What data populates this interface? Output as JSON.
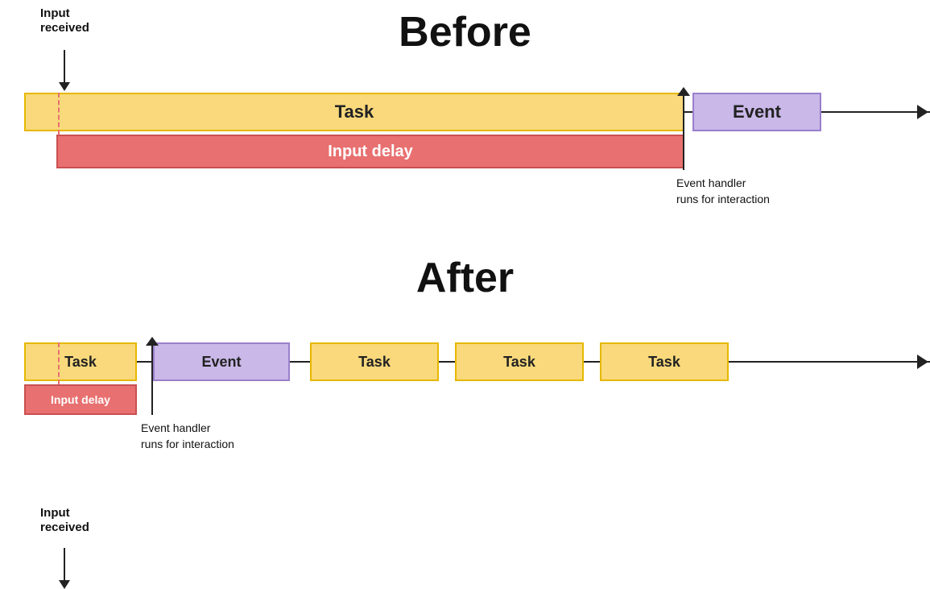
{
  "before": {
    "title": "Before",
    "input_received": "Input\nreceived",
    "task_label": "Task",
    "event_label": "Event",
    "input_delay_label": "Input delay",
    "event_handler_label": "Event handler\nruns for interaction"
  },
  "after": {
    "title": "After",
    "input_received": "Input\nreceived",
    "task_label": "Task",
    "event_label": "Event",
    "input_delay_label": "Input delay",
    "event_handler_label": "Event handler\nruns for interaction",
    "task2_label": "Task",
    "task3_label": "Task",
    "task4_label": "Task"
  }
}
